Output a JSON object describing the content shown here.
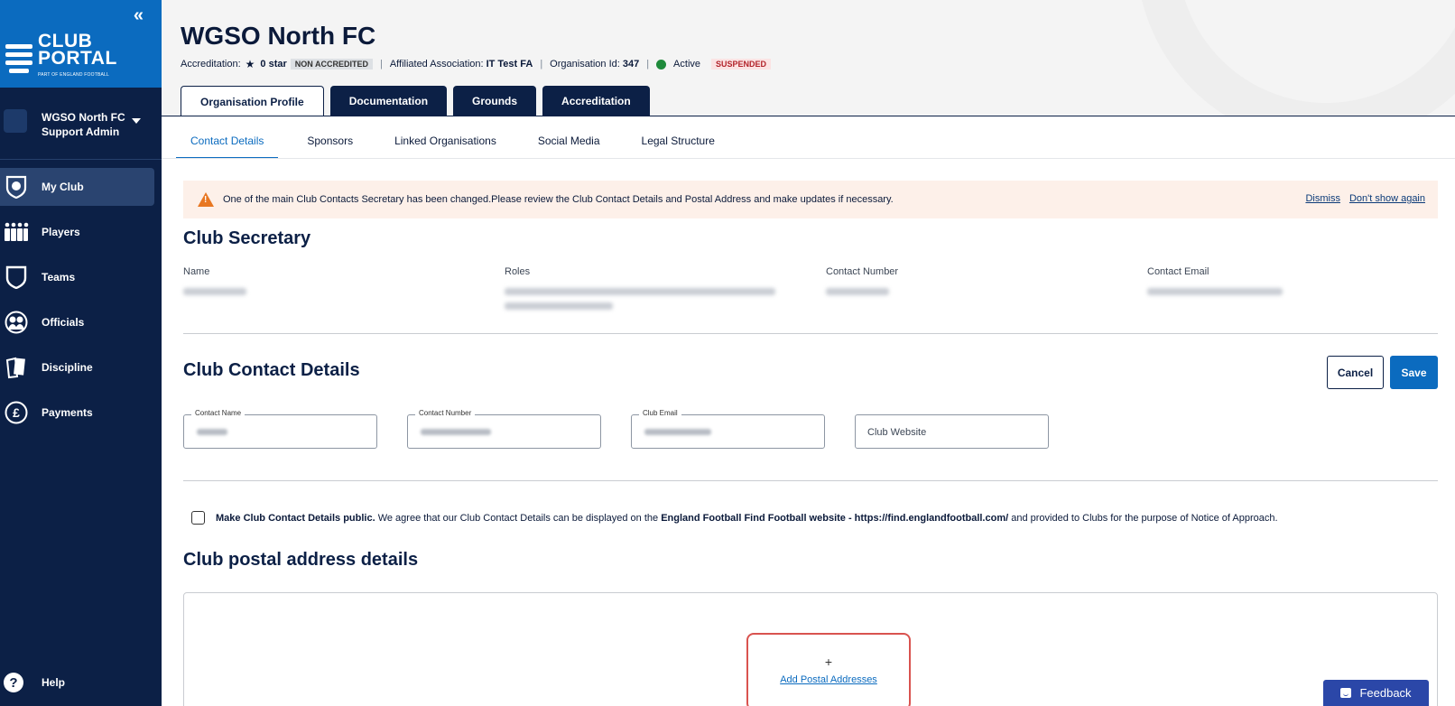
{
  "sidebar": {
    "logo_line1": "CLUB",
    "logo_line2": "PORTAL",
    "logo_tagline": "PART OF ENGLAND FOOTBALL",
    "account_name": "WGSO North FC",
    "account_role": "Support Admin",
    "items": [
      {
        "label": "My Club",
        "icon": "shield-football-icon",
        "active": true
      },
      {
        "label": "Players",
        "icon": "players-icon"
      },
      {
        "label": "Teams",
        "icon": "team-shield-icon"
      },
      {
        "label": "Officials",
        "icon": "officials-icon"
      },
      {
        "label": "Discipline",
        "icon": "discipline-card-icon"
      },
      {
        "label": "Payments",
        "icon": "pound-icon"
      }
    ],
    "help_label": "Help"
  },
  "header": {
    "title": "WGSO North FC",
    "accreditation_label": "Accreditation:",
    "accreditation_value": "0 star",
    "accreditation_badge": "NON ACCREDITED",
    "association_label": "Affiliated Association:",
    "association_value": "IT Test FA",
    "org_id_label": "Organisation Id:",
    "org_id_value": "347",
    "status_label": "Active",
    "status_badge": "SUSPENDED"
  },
  "tabs": [
    "Organisation Profile",
    "Documentation",
    "Grounds",
    "Accreditation"
  ],
  "subtabs": [
    "Contact Details",
    "Sponsors",
    "Linked Organisations",
    "Social Media",
    "Legal Structure"
  ],
  "alert": {
    "message": "One of the main Club Contacts Secretary has been changed.Please review the Club Contact Details and Postal Address and make updates if necessary.",
    "dismiss": "Dismiss",
    "dont_show": "Don't show again"
  },
  "secretary": {
    "heading": "Club Secretary",
    "columns": [
      "Name",
      "Roles",
      "Contact Number",
      "Contact Email"
    ]
  },
  "contact": {
    "heading": "Club Contact Details",
    "cancel": "Cancel",
    "save": "Save",
    "fields": [
      {
        "label": "Contact Name"
      },
      {
        "label": "Contact Number"
      },
      {
        "label": "Club Email"
      },
      {
        "placeholder": "Club Website"
      }
    ],
    "consent_bold": "Make Club Contact Details public.",
    "consent_text": " We agree that our Club Contact Details can be displayed on the ",
    "consent_link": "England Football Find Football website - https://find.englandfootball.com/",
    "consent_tail": " and provided to Clubs for the purpose of Notice of Approach."
  },
  "postal": {
    "heading": "Club postal address details",
    "plus": "+",
    "add_label": "Add Postal Addresses"
  },
  "feedback_label": "Feedback",
  "colors": {
    "navy": "#0c2046",
    "blue": "#0b6bbf",
    "alert_bg": "#fdf0e9",
    "warning": "#e87722",
    "active_green": "#1f8a3b",
    "suspended_red": "#b2232b"
  }
}
